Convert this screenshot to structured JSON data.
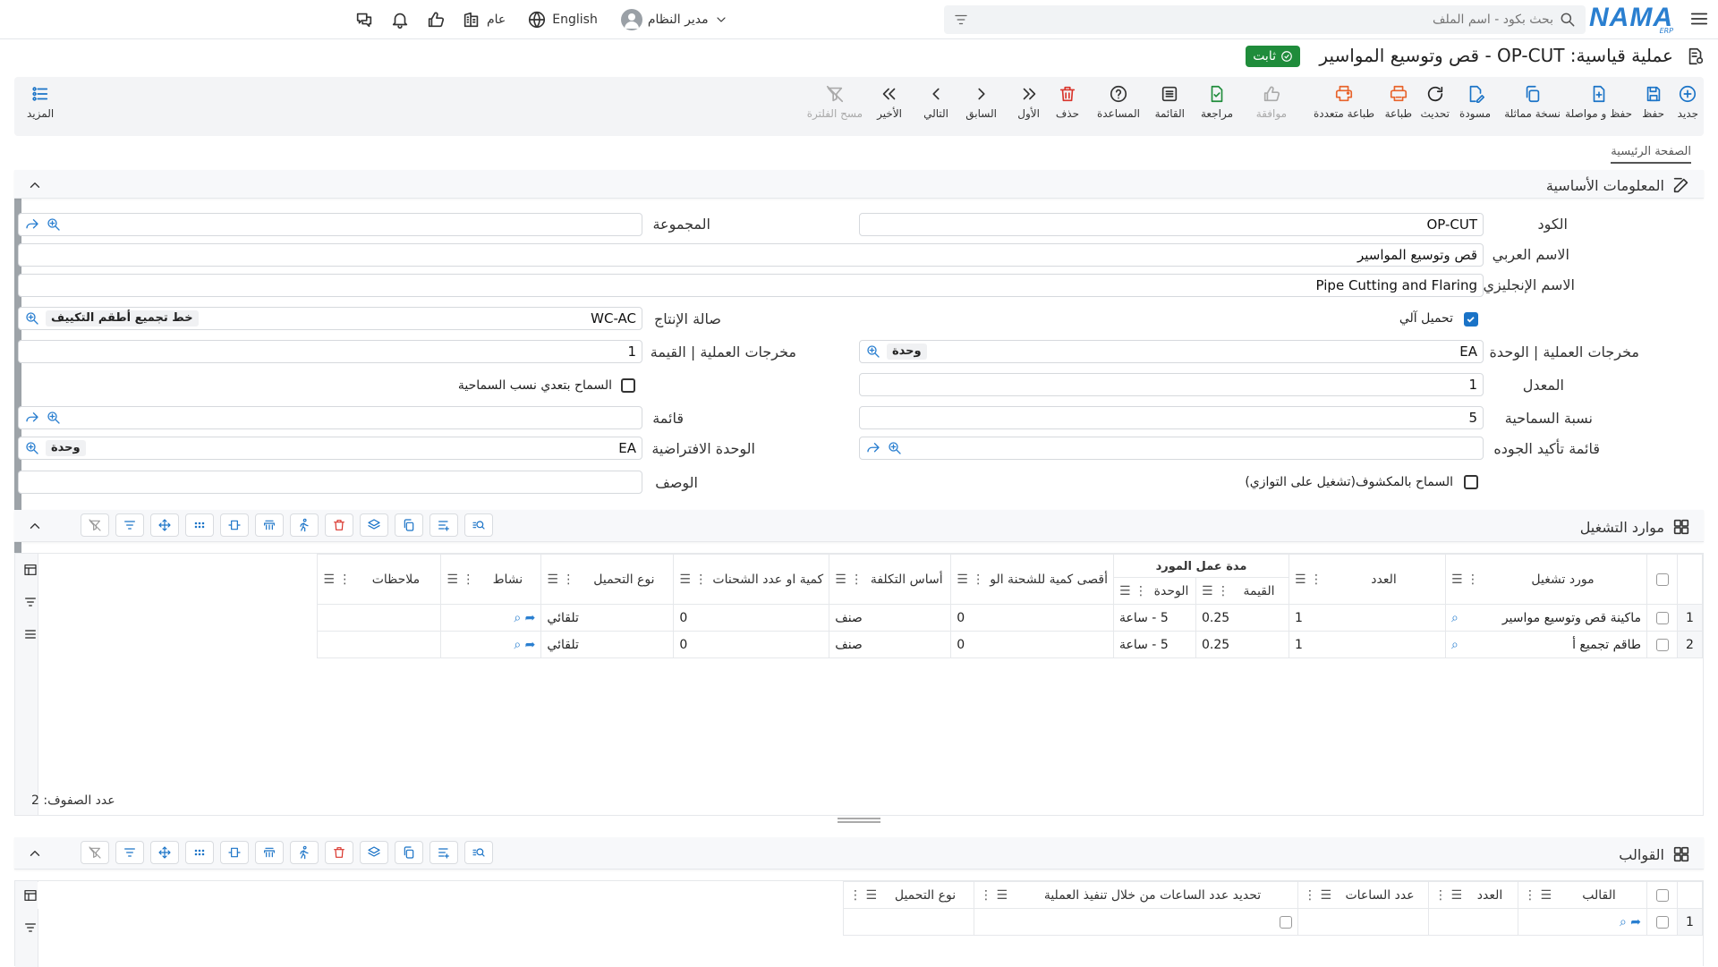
{
  "topbar": {
    "app_name": "NAMA",
    "app_sub": "ERP",
    "search_placeholder": "بحث بكود - اسم الملف",
    "language": "English",
    "branch": "عام",
    "user": "مدير النظام"
  },
  "page": {
    "title": "عملية قياسية: OP-CUT - قص وتوسيع المواسير",
    "status": "ثابت",
    "tab_main": "الصفحة الرئيسية"
  },
  "toolbar": {
    "new": "جديد",
    "save": "حفظ",
    "save_continue": "حفظ و مواصلة",
    "duplicate": "نسخة مماثلة",
    "draft": "مسودة",
    "refresh": "تحديث",
    "print": "طباعة",
    "multi_print": "طباعة متعددة",
    "approve": "موافقة",
    "review": "مراجعة",
    "list": "القائمة",
    "help": "المساعدة",
    "delete": "حذف",
    "first": "الأول",
    "prev": "السابق",
    "next": "التالي",
    "last": "الأخير",
    "clear_filter": "مسح الفلترة",
    "more": "المزيد"
  },
  "basic": {
    "section_title": "المعلومات الأساسية",
    "code_label": "الكود",
    "code_value": "OP-CUT",
    "group_label": "المجموعة",
    "group_value": "",
    "arabic_name_label": "الاسم العربي",
    "arabic_name_value": "قص وتوسيع المواسير",
    "english_name_label": "الاسم الإنجليزي",
    "english_name_value": "Pipe Cutting and Flaring",
    "auto_load_label": "تحميل آلي",
    "hall_label": "صالة الإنتاج",
    "hall_code": "WC-AC",
    "hall_name": "خط تجميع أطقم التكييف",
    "output_unit_label": "مخرجات العملية | الوحدة",
    "output_unit_code": "EA",
    "output_unit_name": "وحدة",
    "output_value_label": "مخرجات العملية | القيمة",
    "output_value": "1",
    "rate_label": "المعدل",
    "rate_value": "1",
    "allow_exceed_label": "السماح بتعدي نسب السماحية",
    "tolerance_label": "نسبة السماحية",
    "tolerance_value": "5",
    "list_label": "قائمة",
    "list_value": "",
    "qa_label": "قائمة تأكيد الجوده",
    "qa_value": "",
    "default_unit_label": "الوحدة الافتراضية",
    "default_unit_code": "EA",
    "default_unit_name": "وحدة",
    "desc_label": "الوصف",
    "desc_value": "",
    "allow_exposed_label": "السماح بالمكشوف(تشغيل على التوازي)"
  },
  "resources": {
    "section_title": "موارد التشغيل",
    "headers": {
      "resource": "مورد تشغيل",
      "count": "العدد",
      "duration_group": "مدة عمل المورد",
      "duration_value": "القيمة",
      "duration_unit": "الوحدة",
      "max_qty": "أقصى كمية للشحنة الو",
      "cost_basis": "أساس التكلفة",
      "qty_shipments": "كمية او عدد الشحنات",
      "load_type": "نوع التحميل",
      "activity": "نشاط",
      "notes": "ملاحظات"
    },
    "rows": [
      {
        "num": "1",
        "resource": "ماكينة قص وتوسيع مواسير",
        "count": "1",
        "dvalue": "0.25",
        "dunit": "5 - ساعة",
        "max_qty": "0",
        "cost_basis": "صنف",
        "qty": "0",
        "load": "تلقائي",
        "notes": ""
      },
      {
        "num": "2",
        "resource": "طاقم تجميع أ",
        "count": "1",
        "dvalue": "0.25",
        "dunit": "5 - ساعة",
        "max_qty": "0",
        "cost_basis": "صنف",
        "qty": "0",
        "load": "تلقائي",
        "notes": ""
      }
    ],
    "row_count": "عدد الصفوف: 2"
  },
  "templates": {
    "section_title": "القوالب",
    "headers": {
      "template": "القالب",
      "count": "العدد",
      "hours": "عدد الساعات",
      "set_hours": "تحديد عدد الساعات من خلال تنفيذ العملية",
      "load_type": "نوع التحميل"
    },
    "rows": [
      {
        "num": "1"
      }
    ]
  },
  "colors": {
    "accent": "#2a7fd0",
    "status_green": "#1f8c3b",
    "checkbox_blue": "#1a73c7",
    "delete_red": "#d9342b",
    "print_orange": "#e8632b"
  }
}
